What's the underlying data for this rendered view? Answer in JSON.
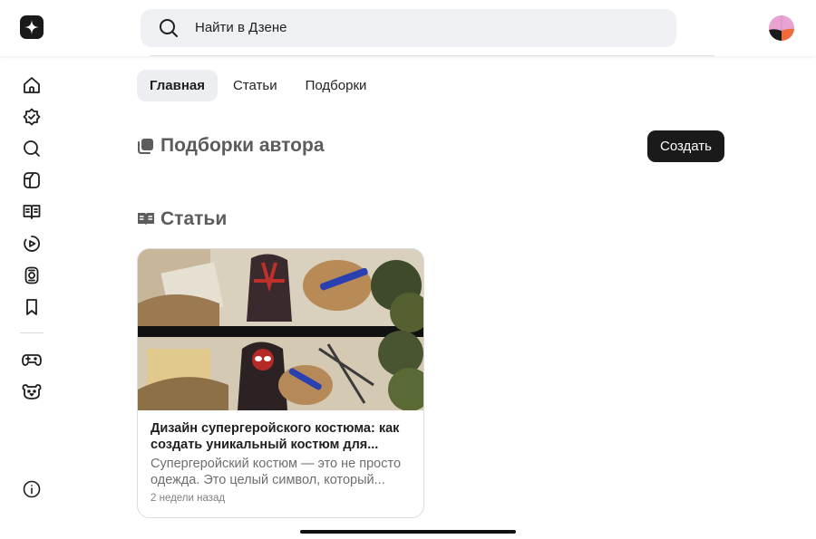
{
  "header": {
    "logo_icon": "dzen-star-icon",
    "search": {
      "placeholder": "Найти в Дзене",
      "icon": "search-icon"
    },
    "avatar": "user-avatar"
  },
  "sidebar": {
    "items": [
      {
        "icon": "home-icon"
      },
      {
        "icon": "subscriptions-icon"
      },
      {
        "icon": "search-icon"
      },
      {
        "icon": "cube-icon"
      },
      {
        "icon": "articles-icon"
      },
      {
        "icon": "video-play-icon"
      },
      {
        "icon": "shorts-icon"
      },
      {
        "icon": "bookmark-icon"
      },
      {
        "icon": "gamepad-icon"
      },
      {
        "icon": "kids-bear-icon"
      },
      {
        "icon": "info-icon"
      }
    ]
  },
  "tabs": [
    {
      "label": "Главная",
      "active": true
    },
    {
      "label": "Статьи",
      "active": false
    },
    {
      "label": "Подборки",
      "active": false
    }
  ],
  "collections": {
    "title": "Подборки автора",
    "create_label": "Создать"
  },
  "articles": {
    "title": "Статьи",
    "items": [
      {
        "title": "Дизайн супергеройского костюма: как создать уникальный костюм для...",
        "snippet": "Супергеройский костюм — это не просто одежда. Это целый символ, который...",
        "time": "2 недели назад"
      }
    ]
  },
  "colors": {
    "accent_dark": "#1a1a1a",
    "tab_active_bg": "#eceef1",
    "section_title": "#5c5c5c"
  }
}
